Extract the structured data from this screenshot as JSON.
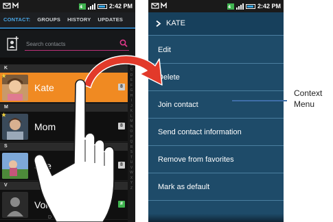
{
  "left_phone": {
    "status_time": "2:42 PM",
    "tabs": [
      {
        "label": "CONTACT:"
      },
      {
        "label": "GROUPS"
      },
      {
        "label": "HISTORY"
      },
      {
        "label": "UPDATES"
      }
    ],
    "search_placeholder": "Search contacts",
    "sections": [
      "K",
      "M",
      "S",
      "V"
    ],
    "contacts": [
      {
        "name": "Kate",
        "highlighted": true
      },
      {
        "name": "Mom",
        "highlighted": false
      },
      {
        "name": "She",
        "highlighted": false
      },
      {
        "name": "Voi",
        "highlighted": false
      }
    ],
    "bottom_text": "D"
  },
  "right_phone": {
    "status_time": "2:42 PM",
    "menu_title": "KATE",
    "menu_items": [
      {
        "label": "Edit"
      },
      {
        "label": "Delete"
      },
      {
        "label": "Join contact"
      },
      {
        "label": "Send contact information"
      },
      {
        "label": "Remove from favorites"
      },
      {
        "label": "Mark as default"
      }
    ]
  },
  "callout": {
    "label_line1": "Context",
    "label_line2": "Menu",
    "color": "#3f6ea8"
  },
  "colors": {
    "highlight_orange": "#f08a22",
    "menu_blue": "#1e4b69",
    "tab_accent": "#4aa8e8",
    "arrow_red": "#e23a2a"
  }
}
